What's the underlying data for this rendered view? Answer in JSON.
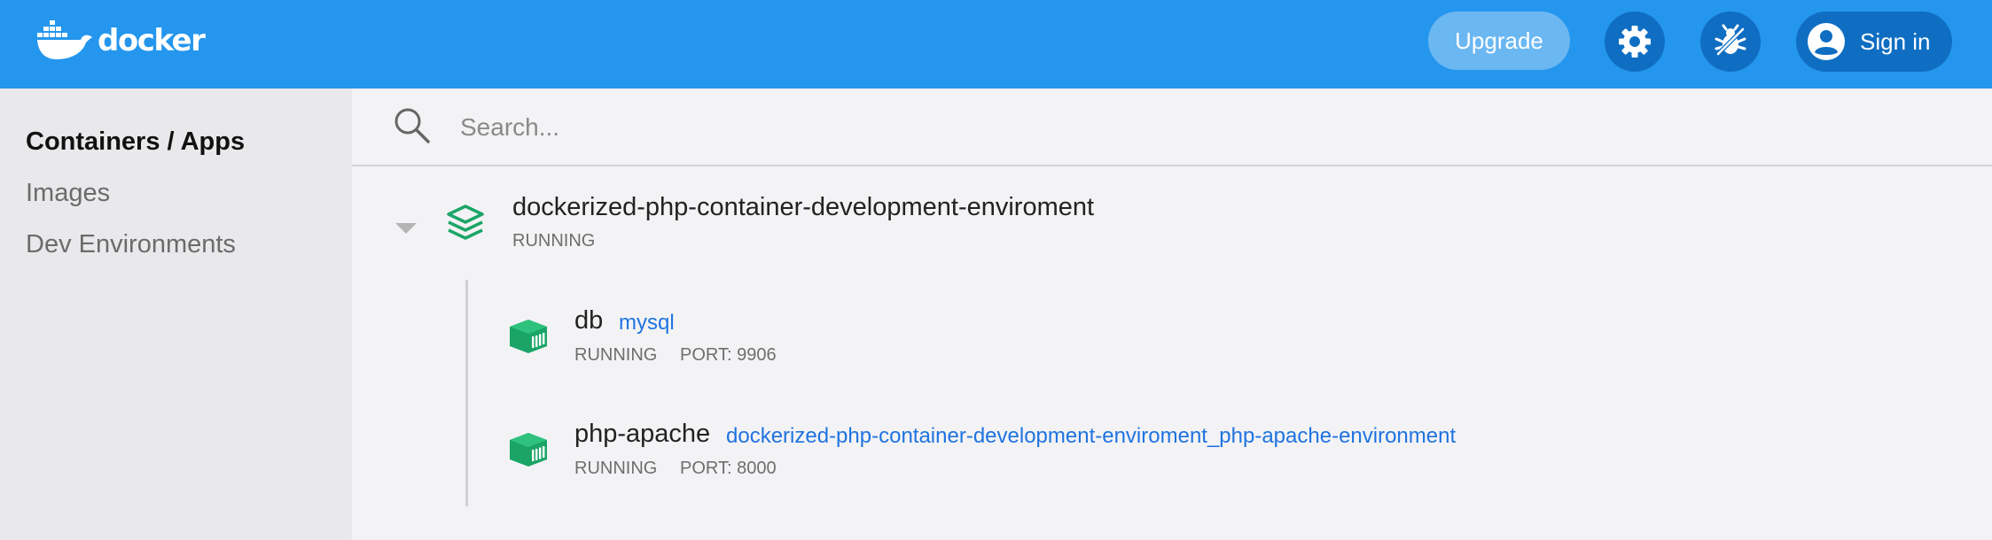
{
  "header": {
    "brand": "docker",
    "upgrade_label": "Upgrade",
    "signin_label": "Sign in",
    "settings_icon": "gear-icon",
    "bug_icon": "bug-icon"
  },
  "sidebar": {
    "items": [
      {
        "label": "Containers / Apps",
        "active": true
      },
      {
        "label": "Images",
        "active": false
      },
      {
        "label": "Dev Environments",
        "active": false
      }
    ]
  },
  "search": {
    "placeholder": "Search..."
  },
  "app": {
    "name": "dockerized-php-container-development-enviroment",
    "status": "RUNNING",
    "containers": [
      {
        "name": "db",
        "image": "mysql",
        "status": "RUNNING",
        "port": "PORT: 9906"
      },
      {
        "name": "php-apache",
        "image": "dockerized-php-container-development-enviroment_php-apache-environment",
        "status": "RUNNING",
        "port": "PORT: 8000"
      }
    ]
  },
  "colors": {
    "header_bg": "#2496ed",
    "accent_dark": "#0f6ec2",
    "running_green": "#1aa567",
    "link_blue": "#1f73e0"
  }
}
